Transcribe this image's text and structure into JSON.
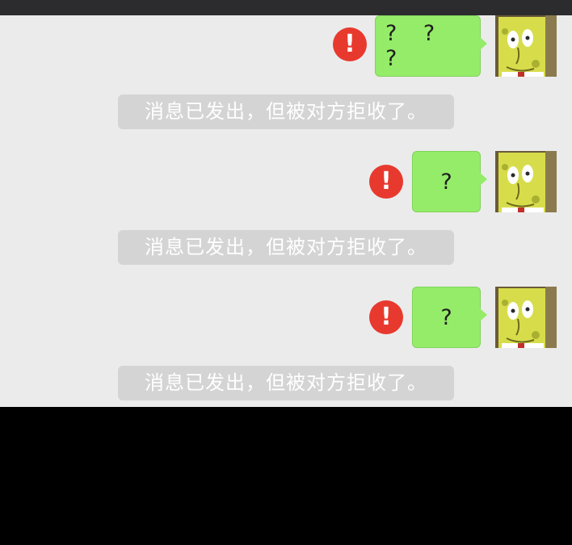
{
  "conversation": {
    "messages": [
      {
        "text": "? ? ?",
        "status": "error",
        "status_icon": "!",
        "avatar_icon": "spongebob-avatar-icon"
      },
      {
        "text": "?",
        "status": "error",
        "status_icon": "!",
        "avatar_icon": "spongebob-avatar-icon"
      },
      {
        "text": "?",
        "status": "error",
        "status_icon": "!",
        "avatar_icon": "spongebob-avatar-icon"
      }
    ],
    "system_notices": [
      "消息已发出，但被对方拒收了。",
      "消息已发出，但被对方拒收了。",
      "消息已发出，但被对方拒收了。"
    ]
  },
  "colors": {
    "chat_background": "#ebebeb",
    "bubble_green": "#95ec69",
    "error_red": "#e8392f",
    "notice_gray": "#d4d4d4"
  }
}
